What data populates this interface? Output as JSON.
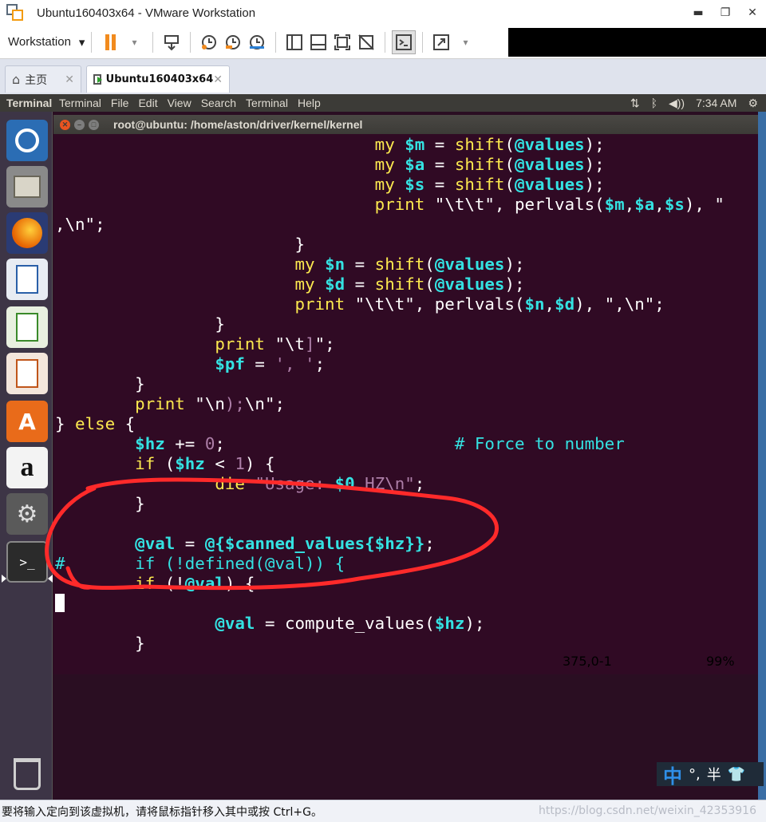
{
  "window": {
    "title": "Ubuntu160403x64 - VMware Workstation",
    "minimize": "▬",
    "maximize": "❐",
    "close": "✕"
  },
  "toolbar": {
    "workstation_label": "Workstation",
    "dropdown_glyph": "▾"
  },
  "tabs": [
    {
      "label": "主页",
      "icon": "home-icon",
      "close": "✕"
    },
    {
      "label": "Ubuntu160403x64",
      "icon": "vm-running-icon",
      "close": "✕"
    }
  ],
  "ubuntu_panel": {
    "app_name": "Terminal",
    "menus": [
      "Terminal",
      "File",
      "Edit",
      "View",
      "Search",
      "Terminal",
      "Help"
    ],
    "clock": "7:34 AM",
    "indicators": [
      "network-icon",
      "bluetooth-icon",
      "volume-icon",
      "gear-icon"
    ]
  },
  "launcher": [
    "ubuntu-dash-icon",
    "files-icon",
    "firefox-icon",
    "writer-icon",
    "calc-icon",
    "impress-icon",
    "software-center-icon",
    "amazon-icon",
    "system-settings-icon",
    "terminal-icon",
    "trash-icon"
  ],
  "terminal": {
    "title": "root@ubuntu: /home/aston/driver/kernel/kernel",
    "status_position": "375,0-1",
    "status_percent": "99%"
  },
  "code_lines": [
    [
      {
        "t": "                                ",
        "c": "w"
      },
      {
        "t": "my ",
        "c": "y"
      },
      {
        "t": "$m",
        "c": "cb"
      },
      {
        "t": " = ",
        "c": "w"
      },
      {
        "t": "shift",
        "c": "y"
      },
      {
        "t": "(",
        "c": "w"
      },
      {
        "t": "@values",
        "c": "cb"
      },
      {
        "t": ");",
        "c": "w"
      }
    ],
    [
      {
        "t": "                                ",
        "c": "w"
      },
      {
        "t": "my ",
        "c": "y"
      },
      {
        "t": "$a",
        "c": "cb"
      },
      {
        "t": " = ",
        "c": "w"
      },
      {
        "t": "shift",
        "c": "y"
      },
      {
        "t": "(",
        "c": "w"
      },
      {
        "t": "@values",
        "c": "cb"
      },
      {
        "t": ");",
        "c": "w"
      }
    ],
    [
      {
        "t": "                                ",
        "c": "w"
      },
      {
        "t": "my ",
        "c": "y"
      },
      {
        "t": "$s",
        "c": "cb"
      },
      {
        "t": " = ",
        "c": "w"
      },
      {
        "t": "shift",
        "c": "y"
      },
      {
        "t": "(",
        "c": "w"
      },
      {
        "t": "@values",
        "c": "cb"
      },
      {
        "t": ");",
        "c": "w"
      }
    ],
    [
      {
        "t": "                                ",
        "c": "w"
      },
      {
        "t": "print ",
        "c": "y"
      },
      {
        "t": "\"\\t\\t\", perlvals(",
        "c": "w"
      },
      {
        "t": "$m",
        "c": "cb"
      },
      {
        "t": ",",
        "c": "w"
      },
      {
        "t": "$a",
        "c": "cb"
      },
      {
        "t": ",",
        "c": "w"
      },
      {
        "t": "$s",
        "c": "cb"
      },
      {
        "t": "), \"",
        "c": "w"
      }
    ],
    [
      {
        "t": ",\\n\";",
        "c": "w"
      }
    ],
    [
      {
        "t": "                        }",
        "c": "w"
      }
    ],
    [
      {
        "t": "                        ",
        "c": "w"
      },
      {
        "t": "my ",
        "c": "y"
      },
      {
        "t": "$n",
        "c": "cb"
      },
      {
        "t": " = ",
        "c": "w"
      },
      {
        "t": "shift",
        "c": "y"
      },
      {
        "t": "(",
        "c": "w"
      },
      {
        "t": "@values",
        "c": "cb"
      },
      {
        "t": ");",
        "c": "w"
      }
    ],
    [
      {
        "t": "                        ",
        "c": "w"
      },
      {
        "t": "my ",
        "c": "y"
      },
      {
        "t": "$d",
        "c": "cb"
      },
      {
        "t": " = ",
        "c": "w"
      },
      {
        "t": "shift",
        "c": "y"
      },
      {
        "t": "(",
        "c": "w"
      },
      {
        "t": "@values",
        "c": "cb"
      },
      {
        "t": ");",
        "c": "w"
      }
    ],
    [
      {
        "t": "                        ",
        "c": "w"
      },
      {
        "t": "print ",
        "c": "y"
      },
      {
        "t": "\"\\t\\t\", perlvals(",
        "c": "w"
      },
      {
        "t": "$n",
        "c": "cb"
      },
      {
        "t": ",",
        "c": "w"
      },
      {
        "t": "$d",
        "c": "cb"
      },
      {
        "t": "), \",\\n\";",
        "c": "w"
      }
    ],
    [
      {
        "t": "                }",
        "c": "w"
      }
    ],
    [
      {
        "t": "                ",
        "c": "w"
      },
      {
        "t": "print ",
        "c": "y"
      },
      {
        "t": "\"\\t",
        "c": "w"
      },
      {
        "t": "]",
        "c": "p"
      },
      {
        "t": "\";",
        "c": "w"
      }
    ],
    [
      {
        "t": "                ",
        "c": "w"
      },
      {
        "t": "$pf",
        "c": "cb"
      },
      {
        "t": " = ",
        "c": "w"
      },
      {
        "t": "', '",
        "c": "p"
      },
      {
        "t": ";",
        "c": "w"
      }
    ],
    [
      {
        "t": "        }",
        "c": "w"
      }
    ],
    [
      {
        "t": "        ",
        "c": "w"
      },
      {
        "t": "print ",
        "c": "y"
      },
      {
        "t": "\"\\n",
        "c": "w"
      },
      {
        "t": ");",
        "c": "p"
      },
      {
        "t": "\\n\";",
        "c": "w"
      }
    ],
    [
      {
        "t": "} ",
        "c": "w"
      },
      {
        "t": "else",
        "c": "y"
      },
      {
        "t": " {",
        "c": "w"
      }
    ],
    [
      {
        "t": "        ",
        "c": "w"
      },
      {
        "t": "$hz",
        "c": "cb"
      },
      {
        "t": " += ",
        "c": "w"
      },
      {
        "t": "0",
        "c": "p"
      },
      {
        "t": ";                       ",
        "c": "w"
      },
      {
        "t": "# Force to number",
        "c": "c"
      }
    ],
    [
      {
        "t": "        ",
        "c": "w"
      },
      {
        "t": "if",
        "c": "y"
      },
      {
        "t": " (",
        "c": "w"
      },
      {
        "t": "$hz",
        "c": "cb"
      },
      {
        "t": " < ",
        "c": "w"
      },
      {
        "t": "1",
        "c": "p"
      },
      {
        "t": ") {",
        "c": "w"
      }
    ],
    [
      {
        "t": "                ",
        "c": "w"
      },
      {
        "t": "die ",
        "c": "y"
      },
      {
        "t": "\"Usage: ",
        "c": "p"
      },
      {
        "t": "$0",
        "c": "cb"
      },
      {
        "t": " HZ\\n\"",
        "c": "p"
      },
      {
        "t": ";",
        "c": "w"
      }
    ],
    [
      {
        "t": "        }",
        "c": "w"
      }
    ],
    [
      {
        "t": "",
        "c": "w"
      }
    ],
    [
      {
        "t": "        ",
        "c": "w"
      },
      {
        "t": "@val",
        "c": "cb"
      },
      {
        "t": " = ",
        "c": "w"
      },
      {
        "t": "@{$canned_values{$hz}}",
        "c": "cb"
      },
      {
        "t": ";",
        "c": "w"
      }
    ],
    [
      {
        "t": "#",
        "c": "c"
      },
      {
        "t": "       ",
        "c": "w"
      },
      {
        "t": "if (!defined(@val)) {",
        "c": "c"
      }
    ],
    [
      {
        "t": "        ",
        "c": "w"
      },
      {
        "t": "if",
        "c": "y"
      },
      {
        "t": " (!",
        "c": "w"
      },
      {
        "t": "@val",
        "c": "cb"
      },
      {
        "t": ") {",
        "c": "w"
      }
    ],
    [
      {
        "t": "CURSOR",
        "c": "cursor"
      }
    ],
    [
      {
        "t": "                ",
        "c": "w"
      },
      {
        "t": "@val",
        "c": "cb"
      },
      {
        "t": " = compute_values(",
        "c": "w"
      },
      {
        "t": "$hz",
        "c": "cb"
      },
      {
        "t": ");",
        "c": "w"
      }
    ],
    [
      {
        "t": "        }",
        "c": "w"
      }
    ]
  ],
  "ime": {
    "mode": "中",
    "punct": "°,",
    "width": "半",
    "skin_icon": "shirt-icon"
  },
  "statusbar": {
    "message": "要将输入定向到该虚拟机，请将鼠标指针移入其中或按 Ctrl+G。",
    "watermark": "https://blog.csdn.net/weixin_42353916"
  },
  "colors": {
    "terminal_bg": "#300a24",
    "keyword": "#fce94f",
    "variable": "#34e2e2",
    "string": "#ad7fa8",
    "annotation": "#ff2a2a"
  }
}
